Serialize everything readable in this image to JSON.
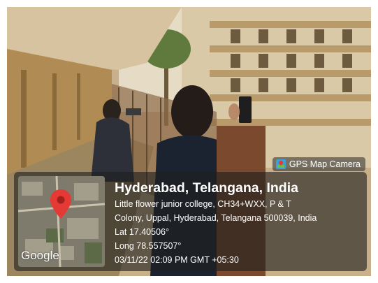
{
  "gps_tag": {
    "label": "GPS Map Camera",
    "icon": "gps-map-camera-icon"
  },
  "location": {
    "title": "Hyderabad, Telangana, India",
    "address_line_1": "Little flower junior college, CH34+WXX, P & T",
    "address_line_2": "Colony, Uppal, Hyderabad, Telangana 500039, India",
    "latitude": "Lat 17.40506°",
    "longitude": "Long 78.557507°",
    "timestamp": "03/11/22 02:09 PM GMT +05:30"
  },
  "map": {
    "provider": "Google",
    "pin_icon": "location-pin-icon",
    "pin_color": "#e53935"
  }
}
